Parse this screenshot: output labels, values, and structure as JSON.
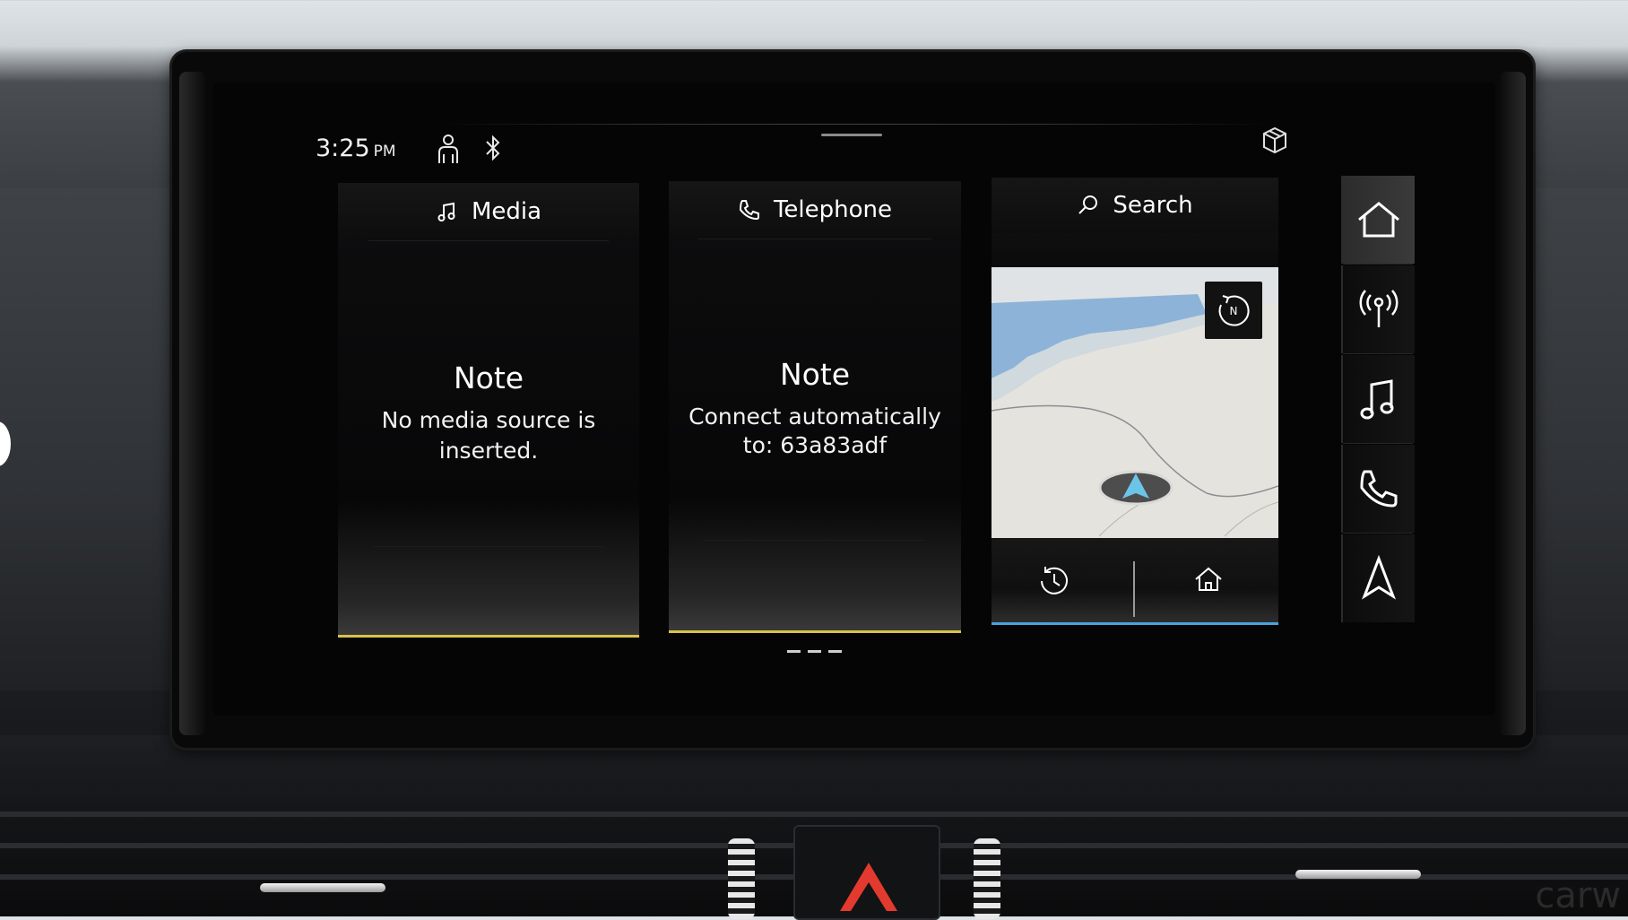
{
  "status_bar": {
    "time": "3:25",
    "ampm": "PM",
    "icons": [
      "profile-icon",
      "bluetooth-icon",
      "cube-icon"
    ]
  },
  "tiles": {
    "media": {
      "header": "Media",
      "icon": "music-note-icon",
      "note_title": "Note",
      "note_line1": "No media source is",
      "note_line2": "inserted."
    },
    "telephone": {
      "header": "Telephone",
      "icon": "phone-icon",
      "note_title": "Note",
      "note_line1": "Connect automatically",
      "note_line2": "to: 63a83adf"
    },
    "navigation": {
      "header": "Search",
      "icon": "search-icon",
      "map_buttons": [
        "compass-north-icon",
        "history-icon",
        "home-icon"
      ]
    }
  },
  "sidebar": {
    "items": [
      {
        "name": "home",
        "icon": "home-icon",
        "active": true
      },
      {
        "name": "radio",
        "icon": "radio-antenna-icon",
        "active": false
      },
      {
        "name": "music",
        "icon": "music-note-icon",
        "active": false
      },
      {
        "name": "phone",
        "icon": "phone-icon",
        "active": false
      },
      {
        "name": "navigation",
        "icon": "navigation-arrow-icon",
        "active": false
      }
    ]
  },
  "page_indicator": {
    "count": 3
  },
  "watermark": "carw",
  "colors": {
    "media_accent": "#d9c24a",
    "phone_accent": "#d9c24a",
    "nav_accent": "#4aa3df",
    "hazard": "#e23a2e"
  }
}
